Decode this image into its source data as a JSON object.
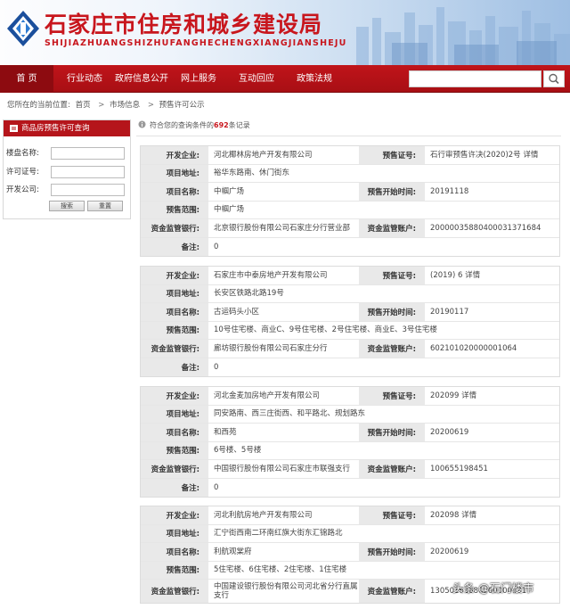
{
  "header": {
    "title": "石家庄市住房和城乡建设局",
    "subtitle": "SHIJIAZHUANGSHIZHUFANGHECHENGXIANGJIANSHEJU"
  },
  "nav": {
    "items": [
      "首 页",
      "行业动态",
      "政府信息公开",
      "网上服务",
      "互动回应",
      "政策法规"
    ],
    "search_value": ""
  },
  "breadcrumb": {
    "prefix": "您所在的当前位置:",
    "items": [
      "首页",
      "市场信息",
      "预售许可公示"
    ],
    "separator": ">"
  },
  "query_panel": {
    "title": "商品房预售许可查询",
    "fields": [
      {
        "label": "楼盘名称:",
        "value": ""
      },
      {
        "label": "许可证号:",
        "value": ""
      },
      {
        "label": "开发公司:",
        "value": ""
      }
    ],
    "search_button": "搜索",
    "reset_button": "重置"
  },
  "results": {
    "count_prefix": "符合您的查询条件的",
    "count": "692",
    "count_suffix": "条记录"
  },
  "labels": {
    "developer": "开发企业:",
    "permit_no": "预售证号:",
    "address": "项目地址:",
    "project_name": "项目名称:",
    "presale_start": "预售开始时间:",
    "presale_scope": "预售范围:",
    "fund_bank": "资金监管银行:",
    "fund_account": "资金监管账户:",
    "remark": "备注:"
  },
  "records": [
    {
      "developer": "河北椰林房地产开发有限公司",
      "permit_no": "石行审预售许决(2020)2号 详情",
      "address": "裕华东路南、休门街东",
      "project_name": "中帼广场",
      "presale_start": "20191118",
      "presale_scope": "中帼广场",
      "fund_bank": "北京银行股份有限公司石家庄分行营业部",
      "fund_account": "20000035880400031371684",
      "remark": "0"
    },
    {
      "developer": "石家庄市中泰房地产开发有限公司",
      "permit_no": "(2019) 6 详情",
      "address": "长安区铁路北路19号",
      "project_name": "古运码头小区",
      "presale_start": "20190117",
      "presale_scope": "10号住宅楼、商业C、9号住宅楼、2号住宅楼、商业E、3号住宅楼",
      "fund_bank": "廊坊银行股份有限公司石家庄分行",
      "fund_account": "602101020000001064",
      "remark": "0"
    },
    {
      "developer": "河北金麦加房地产开发有限公司",
      "permit_no": "202099 详情",
      "address": "同安路南、西三庄街西、和平路北、规划路东",
      "project_name": "和西苑",
      "presale_start": "20200619",
      "presale_scope": "6号楼、5号楼",
      "fund_bank": "中国银行股份有限公司石家庄市联强支行",
      "fund_account": "100655198451",
      "remark": "0"
    },
    {
      "developer": "河北利航房地产开发有限公司",
      "permit_no": "202098 详情",
      "address": "汇宁街西南二环南红旗大街东汇锦路北",
      "project_name": "利航观棠府",
      "presale_start": "20200619",
      "presale_scope": "5住宅楼、6住宅楼、2住宅楼、1住宅楼",
      "fund_bank": "中国建设银行股份有限公司河北省分行直属支行",
      "fund_account": "13050161880100000131",
      "remark": ""
    }
  ],
  "watermark": "头条 @石门楼市",
  "colors": {
    "brand_red": "#c8161d",
    "nav_red": "#b5151b",
    "label_bg": "#e9e9e9"
  }
}
